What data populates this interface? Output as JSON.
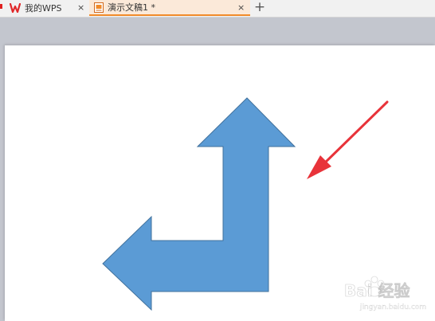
{
  "tabs": [
    {
      "label": "我的WPS",
      "close": "×",
      "active": false
    },
    {
      "label": "演示文稿1 *",
      "close": "×",
      "active": true
    }
  ],
  "new_tab": "+",
  "icons": {
    "wps_logo": "wps-logo-icon",
    "document": "presentation-doc-icon",
    "close": "close-icon",
    "add": "plus-icon"
  },
  "colors": {
    "shape_fill": "#5b9bd5",
    "shape_stroke": "#41719c",
    "annotation_arrow": "#e8333a",
    "active_tab_bg": "#fbe9d9",
    "active_tab_underline": "#f08a2a",
    "workspace_bg": "#c3c6ce"
  },
  "slide": {
    "shape": "bent-up-arrow"
  },
  "watermark": {
    "text": "Bai 经验",
    "url": "jingyan.baidu.com"
  }
}
